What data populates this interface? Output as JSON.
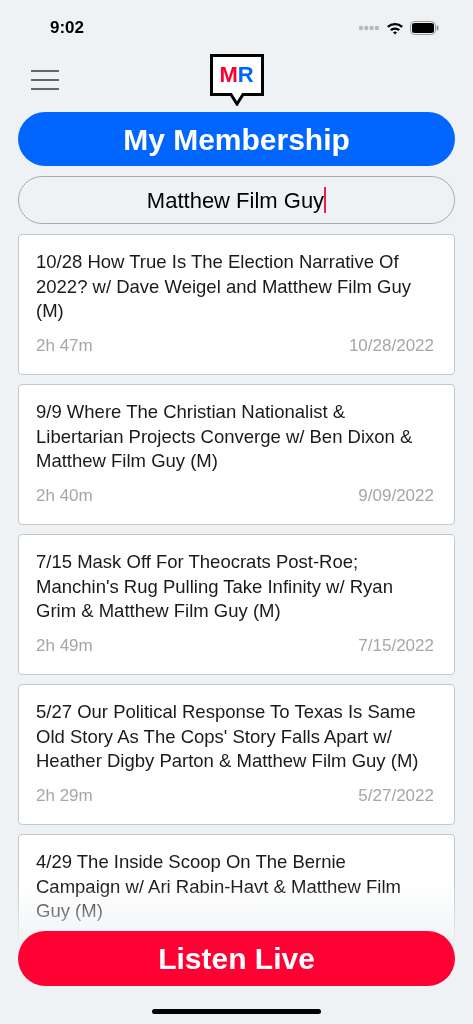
{
  "status_bar": {
    "time": "9:02"
  },
  "logo": {
    "letters": [
      {
        "text": "M",
        "color": "#ff0033"
      },
      {
        "text": "R",
        "color": "#0066ff"
      }
    ]
  },
  "membership_button": "My Membership",
  "search": {
    "value": "Matthew Film Guy"
  },
  "episodes": [
    {
      "title": "10/28 How True Is The Election Narrative Of 2022? w/ Dave Weigel and Matthew Film Guy (M)",
      "duration": "2h 47m",
      "date": "10/28/2022"
    },
    {
      "title": "9/9 Where The Christian Nationalist & Libertarian Projects Converge w/ Ben Dixon & Matthew Film Guy (M)",
      "duration": "2h 40m",
      "date": "9/09/2022"
    },
    {
      "title": "7/15 Mask Off For Theocrats Post-Roe; Manchin's Rug Pulling Take Infinity w/ Ryan Grim & Matthew Film Guy (M)",
      "duration": "2h 49m",
      "date": "7/15/2022"
    },
    {
      "title": "5/27 Our Political Response To Texas Is Same Old Story As The Cops' Story Falls Apart w/ Heather Digby Parton & Matthew Film Guy (M)",
      "duration": "2h 29m",
      "date": "5/27/2022"
    },
    {
      "title": "4/29 The Inside Scoop On The Bernie Campaign w/ Ari Rabin-Havt & Matthew Film Guy (M)"
    }
  ],
  "listen_live_button": "Listen Live"
}
